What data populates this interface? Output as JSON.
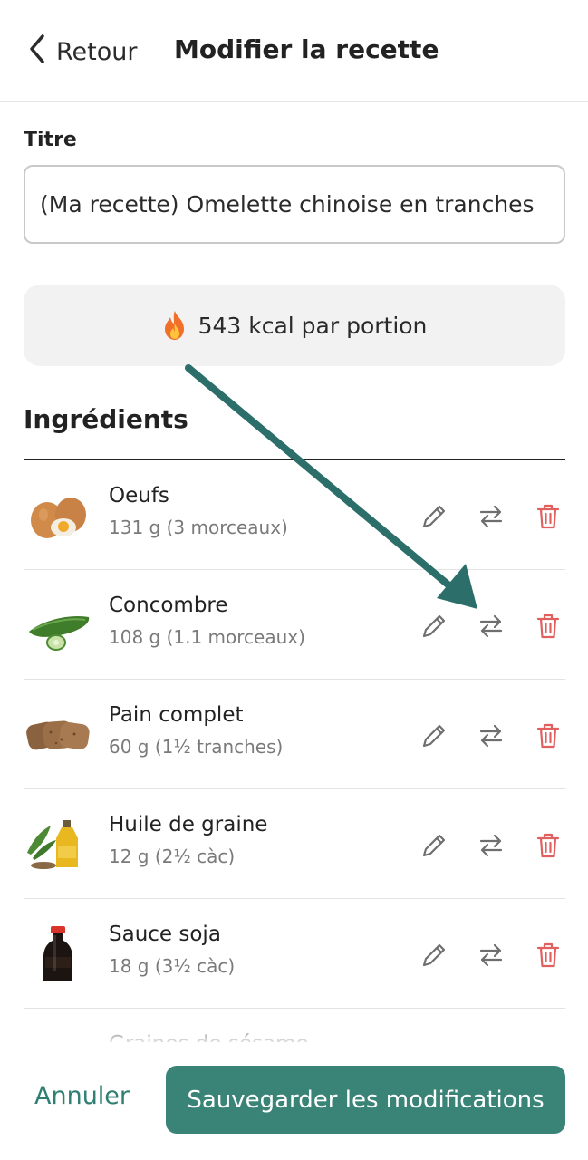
{
  "header": {
    "back_label": "Retour",
    "title": "Modifier la recette"
  },
  "form": {
    "title_label": "Titre",
    "title_value": "(Ma recette) Omelette chinoise en tranches"
  },
  "calories": {
    "icon": "flame-icon",
    "text": "543 kcal par portion"
  },
  "ingredients": {
    "heading": "Ingrédients",
    "items": [
      {
        "name": "Oeufs",
        "quantity": "131 g (3 morceaux)",
        "image": "eggs-image"
      },
      {
        "name": "Concombre",
        "quantity": "108 g (1.1 morceaux)",
        "image": "cucumber-image"
      },
      {
        "name": "Pain complet",
        "quantity": "60 g (1½ tranches)",
        "image": "bread-image"
      },
      {
        "name": "Huile de graine",
        "quantity": "12 g (2½ càc)",
        "image": "seed-oil-image"
      },
      {
        "name": "Sauce soja",
        "quantity": "18 g (3½ càc)",
        "image": "soy-sauce-image"
      },
      {
        "name": "Graines de sésame",
        "quantity": "",
        "image": "sesame-image"
      }
    ]
  },
  "actions": {
    "edit_icon": "pencil-icon",
    "swap_icon": "swap-arrows-icon",
    "delete_icon": "trash-icon"
  },
  "footer": {
    "cancel_label": "Annuler",
    "save_label": "Sauvegarder les modifications"
  },
  "colors": {
    "accent": "#3a8377",
    "accent_text": "#2f7f73",
    "delete": "#e0605f",
    "annotation_arrow": "#2c6e6a"
  }
}
